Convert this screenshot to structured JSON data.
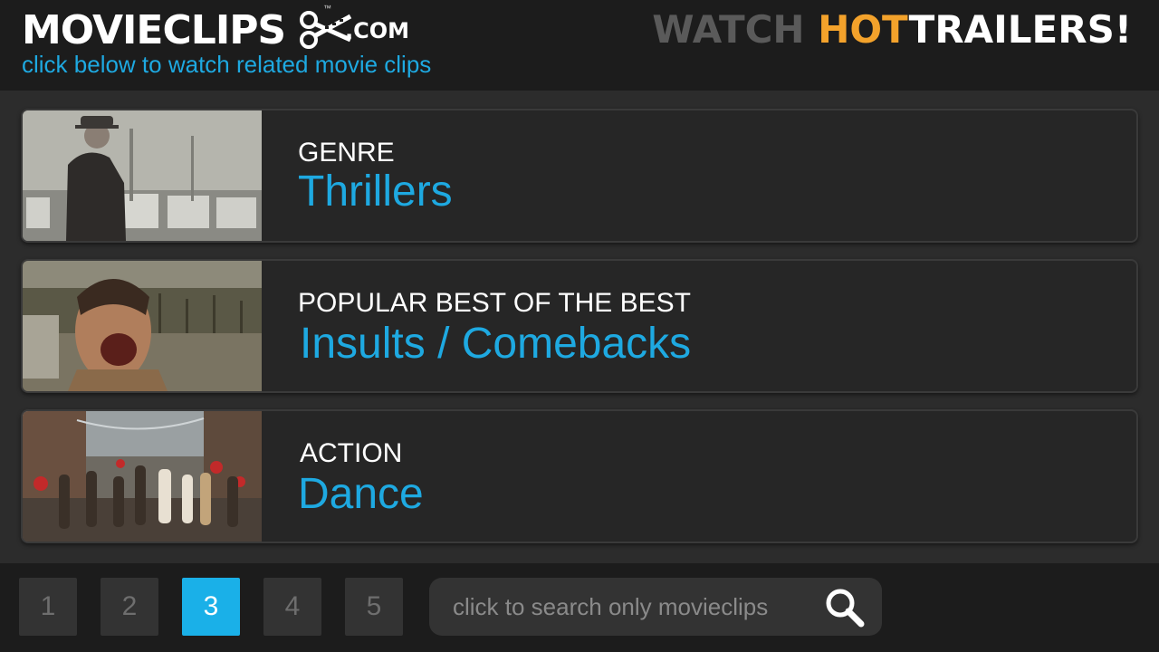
{
  "header": {
    "logo_text": "MOVIECLIPS",
    "logo_tm": "™",
    "logo_domain": ".COM",
    "logo_icon": "scissors-film-icon",
    "tagline": "click below to watch related movie clips",
    "promo": {
      "watch": "WATCH ",
      "hot": "HOT",
      "trailers": "TRAILERS!"
    }
  },
  "cards": [
    {
      "category": "GENRE",
      "title": "Thrillers"
    },
    {
      "category": "POPULAR BEST OF THE BEST",
      "title": "Insults / Comebacks"
    },
    {
      "category": "ACTION",
      "title": "Dance"
    }
  ],
  "pagination": {
    "pages": [
      "1",
      "2",
      "3",
      "4",
      "5"
    ],
    "current": "3"
  },
  "search": {
    "placeholder": "click to search only movieclips",
    "icon": "magnifier-icon"
  },
  "colors": {
    "accent": "#1ea9e1",
    "hot": "#f3a22b",
    "background": "#2c2c2c",
    "bar": "#1c1c1c"
  }
}
